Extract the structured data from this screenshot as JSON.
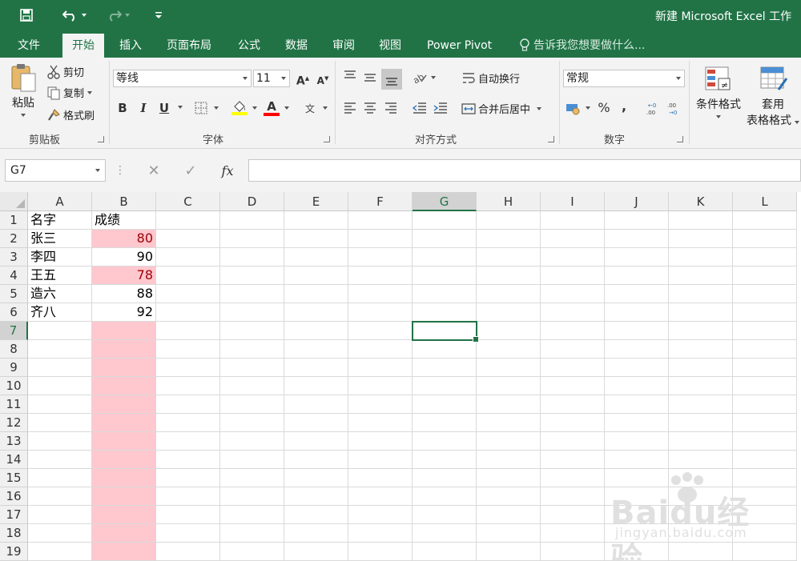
{
  "titlebar": {
    "title": "新建 Microsoft Excel 工作"
  },
  "menu_tabs": [
    "文件",
    "开始",
    "插入",
    "页面布局",
    "公式",
    "数据",
    "审阅",
    "视图",
    "Power Pivot"
  ],
  "tell_me": "告诉我您想要做什么...",
  "ribbon": {
    "clipboard": {
      "paste": "粘贴",
      "cut": "剪切",
      "copy": "复制",
      "format_painter": "格式刷",
      "label": "剪贴板"
    },
    "font": {
      "font_name": "等线",
      "font_size": "11",
      "bold": "B",
      "italic": "I",
      "underline": "U",
      "label": "字体",
      "fill_color": "#ffff00",
      "font_color": "#ff0000"
    },
    "alignment": {
      "wrap_text": "自动换行",
      "merge_center": "合并后居中",
      "label": "对齐方式"
    },
    "number": {
      "format": "常规",
      "percent": "%",
      "comma": ",",
      "label": "数字"
    },
    "styles": {
      "conditional_format": "条件格式",
      "table_format_1": "套用",
      "table_format_2": "表格格式"
    }
  },
  "formula_bar": {
    "name_box": "G7",
    "fx": "fx",
    "value": ""
  },
  "grid": {
    "columns": [
      "A",
      "B",
      "C",
      "D",
      "E",
      "F",
      "G",
      "H",
      "I",
      "J",
      "K",
      "L"
    ],
    "rows": [
      "1",
      "2",
      "3",
      "4",
      "5",
      "6",
      "7",
      "8",
      "9",
      "10",
      "11",
      "12",
      "13",
      "14",
      "15",
      "16",
      "17",
      "18",
      "19"
    ],
    "selected_column": "G",
    "selected_row": "7",
    "header": [
      "名字",
      "成绩"
    ],
    "data": [
      {
        "name": "张三",
        "score": "80",
        "highlight": true
      },
      {
        "name": "李四",
        "score": "90",
        "highlight": false
      },
      {
        "name": "王五",
        "score": "78",
        "highlight": true
      },
      {
        "name": "造六",
        "score": "88",
        "highlight": false
      },
      {
        "name": "齐八",
        "score": "92",
        "highlight": false
      }
    ],
    "highlight_color": "#ffc7ce",
    "highlight_text_color": "#9c0006"
  },
  "watermark": {
    "brand": "Baidu经验",
    "sub": "jingyan.baidu.com"
  }
}
